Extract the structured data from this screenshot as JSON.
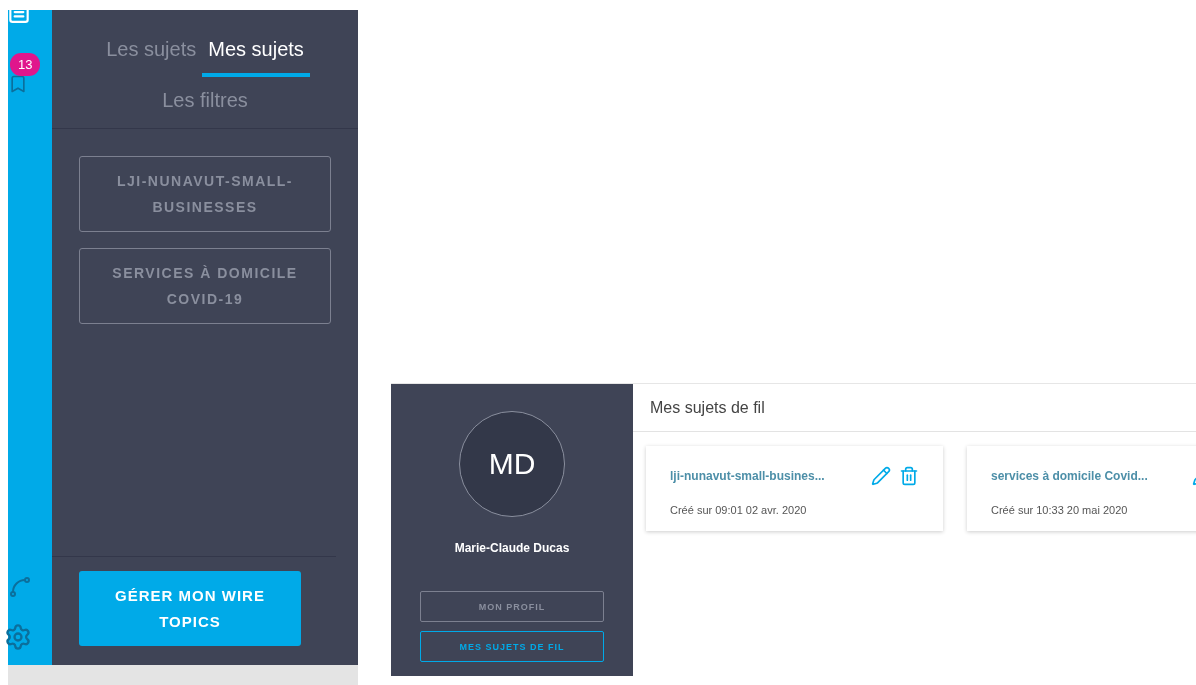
{
  "rail": {
    "badge": "13"
  },
  "topics_panel": {
    "tabs": [
      {
        "label": "Les sujets",
        "selected": false
      },
      {
        "label": "Mes sujets",
        "selected": true
      },
      {
        "label": "Les filtres",
        "selected": false
      }
    ],
    "topics": [
      "LJI-NUNAVUT-SMALL-BUSINESSES",
      "SERVICES À DOMICILE COVID-19"
    ],
    "manage_button": "GÉRER MON WIRE TOPICS"
  },
  "profile": {
    "initials": "MD",
    "name": "Marie-Claude Ducas",
    "menu": [
      {
        "label": "MON PROFIL",
        "selected": false
      },
      {
        "label": "MES SUJETS DE FIL",
        "selected": true
      }
    ]
  },
  "content": {
    "title": "Mes sujets de fil",
    "cards": [
      {
        "title": "lji-nunavut-small-busines...",
        "created": "Créé sur 09:01 02 avr. 2020"
      },
      {
        "title": "services à domicile Covid...",
        "created": "Créé sur 10:33 20 mai 2020"
      }
    ]
  }
}
